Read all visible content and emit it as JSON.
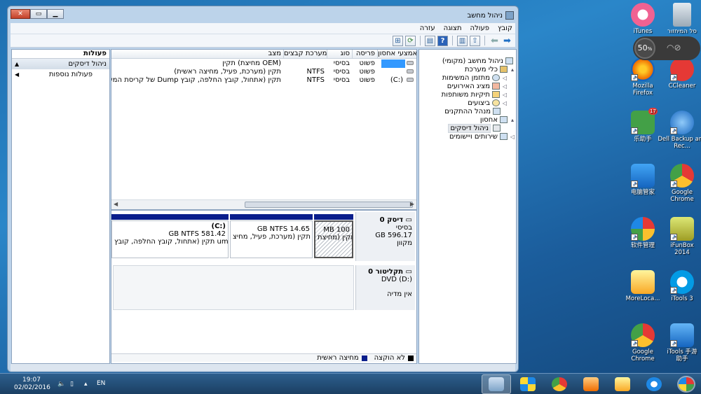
{
  "window": {
    "title": "ניהול מחשב",
    "menu": [
      "קובץ",
      "פעולה",
      "תצוגה",
      "עזרה"
    ]
  },
  "tree": {
    "items": [
      {
        "label": "ניהול מחשב (מקומי)",
        "icon": "computer-management-icon",
        "expander": ""
      },
      {
        "label": "כלי מערכת",
        "icon": "tools-icon",
        "expander": "▴"
      },
      {
        "label": "מתזמן המשימות",
        "icon": "clock-icon",
        "expander": "◁"
      },
      {
        "label": "מציג האירועים",
        "icon": "event-viewer-icon",
        "expander": "◁"
      },
      {
        "label": "תיקיות משותפות",
        "icon": "shared-folder-icon",
        "expander": "◁"
      },
      {
        "label": "ביצועים",
        "icon": "performance-icon",
        "expander": "◁"
      },
      {
        "label": "מנהל ההתקנים",
        "icon": "device-manager-icon",
        "expander": ""
      },
      {
        "label": "אחסון",
        "icon": "storage-icon",
        "expander": "▴"
      },
      {
        "label": "ניהול דיסקים",
        "icon": "disk-management-icon",
        "expander": ""
      },
      {
        "label": "שירותים ויישומים",
        "icon": "services-icon",
        "expander": "◁"
      }
    ]
  },
  "volumes": {
    "columns": [
      "אמצעי אחסון",
      "פריסה",
      "סוג",
      "מערכת קבצים",
      "מצב"
    ],
    "rows": [
      {
        "volume": "",
        "layout": "פשוט",
        "type": "בסיסי",
        "fs": "",
        "status": "תקין (מחיצת OEM)"
      },
      {
        "volume": "",
        "layout": "פשוט",
        "type": "בסיסי",
        "fs": "NTFS",
        "status": "תקין (מערכת, פעיל, מחיצה ראשית)"
      },
      {
        "volume": "(C:)",
        "layout": "פשוט",
        "type": "בסיסי",
        "fs": "NTFS",
        "status": "תקין (אתחול, קובץ החלפה, קובץ Dump של קריסת המערכת"
      }
    ]
  },
  "disks": {
    "disk0": {
      "name": "דיסק 0",
      "type": "בסיסי",
      "size": "GB 596.17",
      "state": "מקוון"
    },
    "partitions": [
      {
        "label": "",
        "size": "MB 100",
        "status": "תקין (מחיצת",
        "hatched": true
      },
      {
        "label": "",
        "size": "GB NTFS 14.65",
        "status": "תקין (מערכת, פעיל, מחיצ",
        "hatched": false
      },
      {
        "label": "(C:)",
        "size": "GB NTFS 581.42",
        "status": "תקין (אתחול, קובץ החלפה, קובץ ump",
        "hatched": false
      }
    ],
    "cdrom": {
      "name": "תקליטור 0",
      "drive": "DVD (D:)",
      "media": "אין מדיה"
    }
  },
  "legend": {
    "unallocated": "לא הוקצה",
    "primary": "מחיצה ראשית",
    "unallocated_color": "#000000",
    "primary_color": "#0a1e8c"
  },
  "actions": {
    "title": "פעולות",
    "section": "ניהול דיסקים",
    "more": "פעולות נוספות"
  },
  "taskbar": {
    "time": "19:07",
    "date": "02/02/2016",
    "lang": "EN"
  },
  "desktop": {
    "icons": [
      {
        "label": "סל המיחזור",
        "color": "#b0bec5"
      },
      {
        "label": "iTunes",
        "color": "#f06292"
      },
      {
        "label": "CCleaner",
        "color": "#e53935"
      },
      {
        "label": "Mozilla Firefox",
        "color": "#ff7043"
      },
      {
        "label": "Dell Backup and Rec...",
        "color": "#1e88e5"
      },
      {
        "label": "乐助手",
        "color": "#43a047"
      },
      {
        "label": "Google Chrome",
        "color": "#fbc02d"
      },
      {
        "label": "电脑管家",
        "color": "#1e88e5"
      },
      {
        "label": "iFunBox 2014",
        "color": "#9e9d24"
      },
      {
        "label": "软件管理",
        "color": "#66bb6a"
      },
      {
        "label": "iTools 3",
        "color": "#039be5"
      },
      {
        "label": "MoreLoca...",
        "color": "#fdd835"
      },
      {
        "label": "iTools 手游助手",
        "color": "#1e88e5"
      },
      {
        "label": "Google Chrome",
        "color": "#fbc02d"
      }
    ],
    "badge": "17"
  },
  "widget": {
    "percent": "50",
    "unit": "%"
  }
}
